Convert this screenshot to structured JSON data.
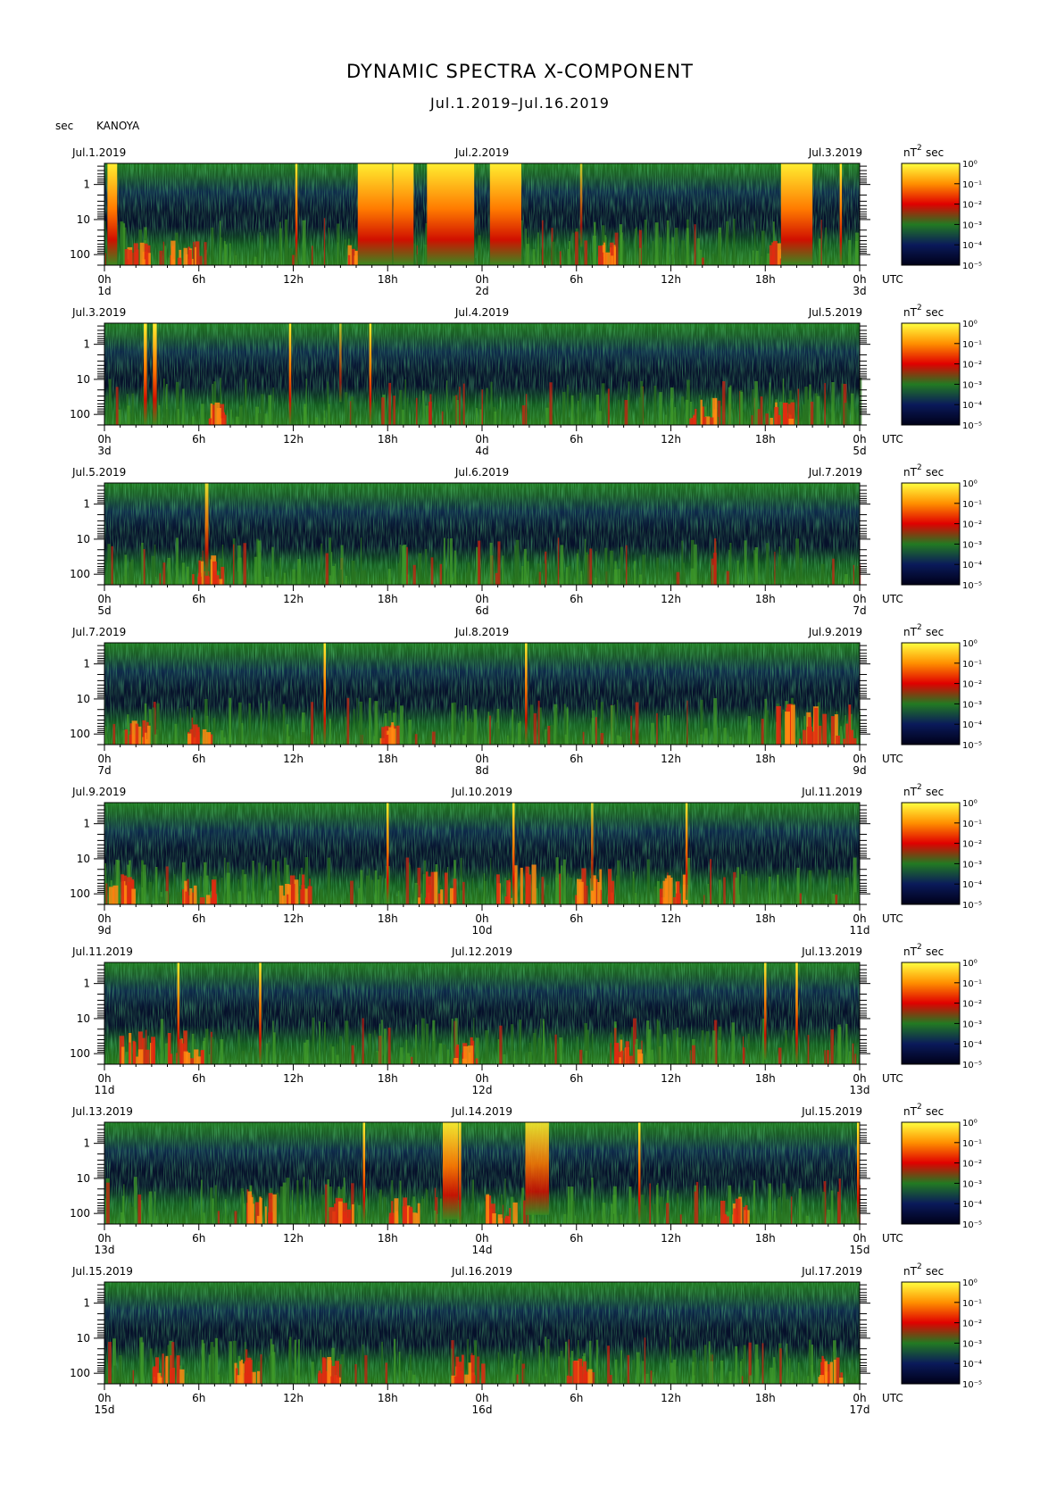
{
  "title": "DYNAMIC SPECTRA X-COMPONENT",
  "subtitle": "Jul.1.2019–Jul.16.2019",
  "y_unit": "sec",
  "station": "KANOYA",
  "colorbar_unit": "nT",
  "colorbar_unit_exp": "2",
  "colorbar_unit_sec": "sec",
  "utc_label": "UTC",
  "colors": {
    "background_spectrum": "#1f6b1f",
    "low_power": "#0a1230",
    "high_power": "#ffe000"
  },
  "chart_data": {
    "type": "heatmap",
    "y_axis": {
      "label": "sec",
      "tick_labels": [
        "1",
        "10",
        "100"
      ],
      "scale": "log"
    },
    "x_tick_labels": [
      "0h",
      "6h",
      "12h",
      "18h",
      "0h",
      "6h",
      "12h",
      "18h",
      "0h"
    ],
    "colorbar": {
      "tick_labels": [
        "10⁰",
        "10⁻¹",
        "10⁻²",
        "10⁻³",
        "10⁻⁴",
        "10⁻⁵"
      ],
      "colors": [
        "#ffff40",
        "#ff9000",
        "#e00000",
        "#227a22",
        "#0a1a5a",
        "#000018"
      ]
    },
    "panels": [
      {
        "left_date": "Jul.1.2019",
        "mid_date": "Jul.2.2019",
        "right_date": "Jul.3.2019",
        "day_labels": [
          "1d",
          "2d",
          "3d"
        ],
        "events": [
          [
            0.5,
            0.62,
            1
          ],
          [
            12.2,
            0.06,
            1
          ],
          [
            17.2,
            2.2,
            1
          ],
          [
            19,
            1.3,
            1
          ],
          [
            22,
            3,
            1
          ],
          [
            25.5,
            2,
            1
          ],
          [
            30.3,
            0.12,
            0.6
          ],
          [
            44,
            2,
            1
          ],
          [
            46.8,
            0.1,
            1
          ]
        ],
        "bursts": [
          [
            2,
            0.3
          ],
          [
            5,
            0.4
          ],
          [
            16,
            0.2
          ],
          [
            32,
            0.2
          ],
          [
            43,
            0.3
          ]
        ]
      },
      {
        "left_date": "Jul.3.2019",
        "mid_date": "Jul.4.2019",
        "right_date": "Jul.5.2019",
        "day_labels": [
          "3d",
          "4d",
          "5d"
        ],
        "events": [
          [
            2.6,
            0.2,
            1
          ],
          [
            3.2,
            0.25,
            1
          ],
          [
            11.8,
            0.07,
            1
          ],
          [
            15,
            0.1,
            0.5
          ],
          [
            16.9,
            0.06,
            1
          ]
        ],
        "bursts": [
          [
            7,
            0.2
          ],
          [
            38,
            0.4
          ],
          [
            43,
            0.3
          ]
        ]
      },
      {
        "left_date": "Jul.5.2019",
        "mid_date": "Jul.6.2019",
        "right_date": "Jul.7.2019",
        "day_labels": [
          "5d",
          "6d",
          "7d"
        ],
        "events": [
          [
            6.5,
            0.22,
            0.8
          ]
        ],
        "bursts": [
          [
            6.5,
            0.5
          ]
        ]
      },
      {
        "left_date": "Jul.7.2019",
        "mid_date": "Jul.8.2019",
        "right_date": "Jul.9.2019",
        "day_labels": [
          "7d",
          "8d",
          "9d"
        ],
        "events": [
          [
            14,
            0.06,
            1
          ],
          [
            26.8,
            0.06,
            1
          ]
        ],
        "bursts": [
          [
            2,
            0.3
          ],
          [
            6,
            0.3
          ],
          [
            18,
            0.2
          ],
          [
            44,
            1
          ],
          [
            46,
            1
          ]
        ]
      },
      {
        "left_date": "Jul.9.2019",
        "mid_date": "Jul.10.2019",
        "right_date": "Jul.11.2019",
        "day_labels": [
          "9d",
          "10d",
          "11d"
        ],
        "events": [
          [
            18,
            0.06,
            1
          ],
          [
            26,
            0.06,
            1
          ],
          [
            31,
            0.06,
            0.7
          ],
          [
            37,
            0.06,
            0.9
          ]
        ],
        "bursts": [
          [
            1,
            0.5
          ],
          [
            6,
            0.6
          ],
          [
            12,
            0.5
          ],
          [
            21,
            0.7
          ],
          [
            26,
            0.9
          ],
          [
            31,
            0.8
          ],
          [
            36,
            0.5
          ]
        ]
      },
      {
        "left_date": "Jul.11.2019",
        "mid_date": "Jul.12.2019",
        "right_date": "Jul.13.2019",
        "day_labels": [
          "11d",
          "12d",
          "13d"
        ],
        "events": [
          [
            4.7,
            0.06,
            1
          ],
          [
            9.9,
            0.06,
            1
          ],
          [
            42,
            0.06,
            0.9
          ],
          [
            44,
            0.06,
            1
          ]
        ],
        "bursts": [
          [
            2,
            0.6
          ],
          [
            5,
            0.7
          ],
          [
            23,
            0.4
          ],
          [
            33,
            0.5
          ]
        ]
      },
      {
        "left_date": "Jul.13.2019",
        "mid_date": "Jul.14.2019",
        "right_date": "Jul.15.2019",
        "day_labels": [
          "13d",
          "14d",
          "15d"
        ],
        "events": [
          [
            16.5,
            0.06,
            1
          ],
          [
            22,
            1,
            0.9
          ],
          [
            22.6,
            0.06,
            1
          ],
          [
            27.5,
            1.5,
            0.8
          ],
          [
            34,
            0.06,
            1
          ],
          [
            47.9,
            0.08,
            1
          ]
        ],
        "bursts": [
          [
            10,
            0.6
          ],
          [
            15,
            0.4
          ],
          [
            19,
            0.5
          ],
          [
            25,
            0.5
          ],
          [
            40,
            0.4
          ]
        ]
      },
      {
        "left_date": "Jul.15.2019",
        "mid_date": "Jul.16.2019",
        "right_date": "Jul.17.2019",
        "day_labels": [
          "15d",
          "16d",
          "17d"
        ],
        "events": [],
        "bursts": [
          [
            4,
            0.5
          ],
          [
            9,
            0.4
          ],
          [
            14,
            0.4
          ],
          [
            23,
            0.5
          ],
          [
            30,
            0.3
          ],
          [
            46,
            0.4
          ]
        ]
      }
    ]
  }
}
